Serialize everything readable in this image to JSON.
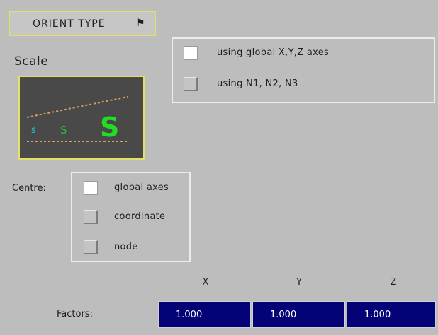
{
  "orient_type": {
    "label": "ORIENT TYPE",
    "arrow_icon": "flag-arrow-icon"
  },
  "scale": {
    "label": "Scale",
    "preview_letters": [
      "s",
      "S",
      "S"
    ]
  },
  "orient_options": [
    {
      "label": "using global X,Y,Z axes",
      "selected": true
    },
    {
      "label": "using N1, N2, N3",
      "selected": false
    }
  ],
  "centre": {
    "label": "Centre:",
    "options": [
      {
        "label": "global axes",
        "selected": true
      },
      {
        "label": "coordinate",
        "selected": false
      },
      {
        "label": "node",
        "selected": false
      }
    ]
  },
  "factors": {
    "label": "Factors:",
    "headers": [
      "X",
      "Y",
      "Z"
    ],
    "values": [
      "1.000",
      "1.000",
      "1.000"
    ]
  },
  "colors": {
    "field_bg": "#030377",
    "highlight_border": "#e3e067",
    "preview_bg": "#494949",
    "green": "#22dd22",
    "cyan": "#22c8c8"
  }
}
